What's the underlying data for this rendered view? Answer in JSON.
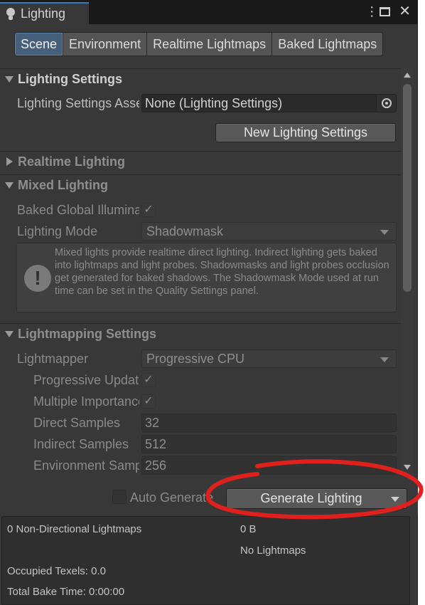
{
  "window": {
    "tab_title": "Lighting",
    "menu_icon": "kebab-menu-icon",
    "maximize_icon": "maximize-icon",
    "close_icon": "close-icon"
  },
  "toolbar": {
    "tabs": [
      "Scene",
      "Environment",
      "Realtime Lightmaps",
      "Baked Lightmaps"
    ],
    "active": "Scene"
  },
  "lighting_settings": {
    "header": "Lighting Settings",
    "asset_label": "Lighting Settings Asset",
    "asset_value": "None (Lighting Settings)",
    "new_button": "New Lighting Settings"
  },
  "realtime_lighting": {
    "header": "Realtime Lighting"
  },
  "mixed_lighting": {
    "header": "Mixed Lighting",
    "baked_gi_label": "Baked Global Illumination",
    "baked_gi_checked": "✓",
    "mode_label": "Lighting Mode",
    "mode_value": "Shadowmask",
    "help_text": "Mixed lights provide realtime direct lighting. Indirect lighting gets baked into lightmaps and light probes. Shadowmasks and light probes occlusion get generated for baked shadows. The Shadowmask Mode used at run time can be set in the Quality Settings panel.",
    "help_icon": "!"
  },
  "lightmapping": {
    "header": "Lightmapping Settings",
    "lightmapper_label": "Lightmapper",
    "lightmapper_value": "Progressive CPU",
    "progressive_label": "Progressive Updates",
    "progressive_checked": "✓",
    "mis_label": "Multiple Importance Sampling",
    "mis_checked": "✓",
    "direct_label": "Direct Samples",
    "direct_value": "32",
    "indirect_label": "Indirect Samples",
    "indirect_value": "512",
    "env_label": "Environment Samples",
    "env_value": "256"
  },
  "bake": {
    "auto_label": "Auto Generate",
    "generate_label": "Generate Lighting"
  },
  "stats": {
    "lightmaps": "0 Non-Directional Lightmaps",
    "size": "0 B",
    "no_lightmaps": "No Lightmaps",
    "texels": "Occupied Texels: 0.0",
    "bake_time": "Total Bake Time: 0:00:00"
  },
  "colors": {
    "panel": "#383838",
    "active_tab": "#46607c",
    "annotation": "#e0201c"
  }
}
